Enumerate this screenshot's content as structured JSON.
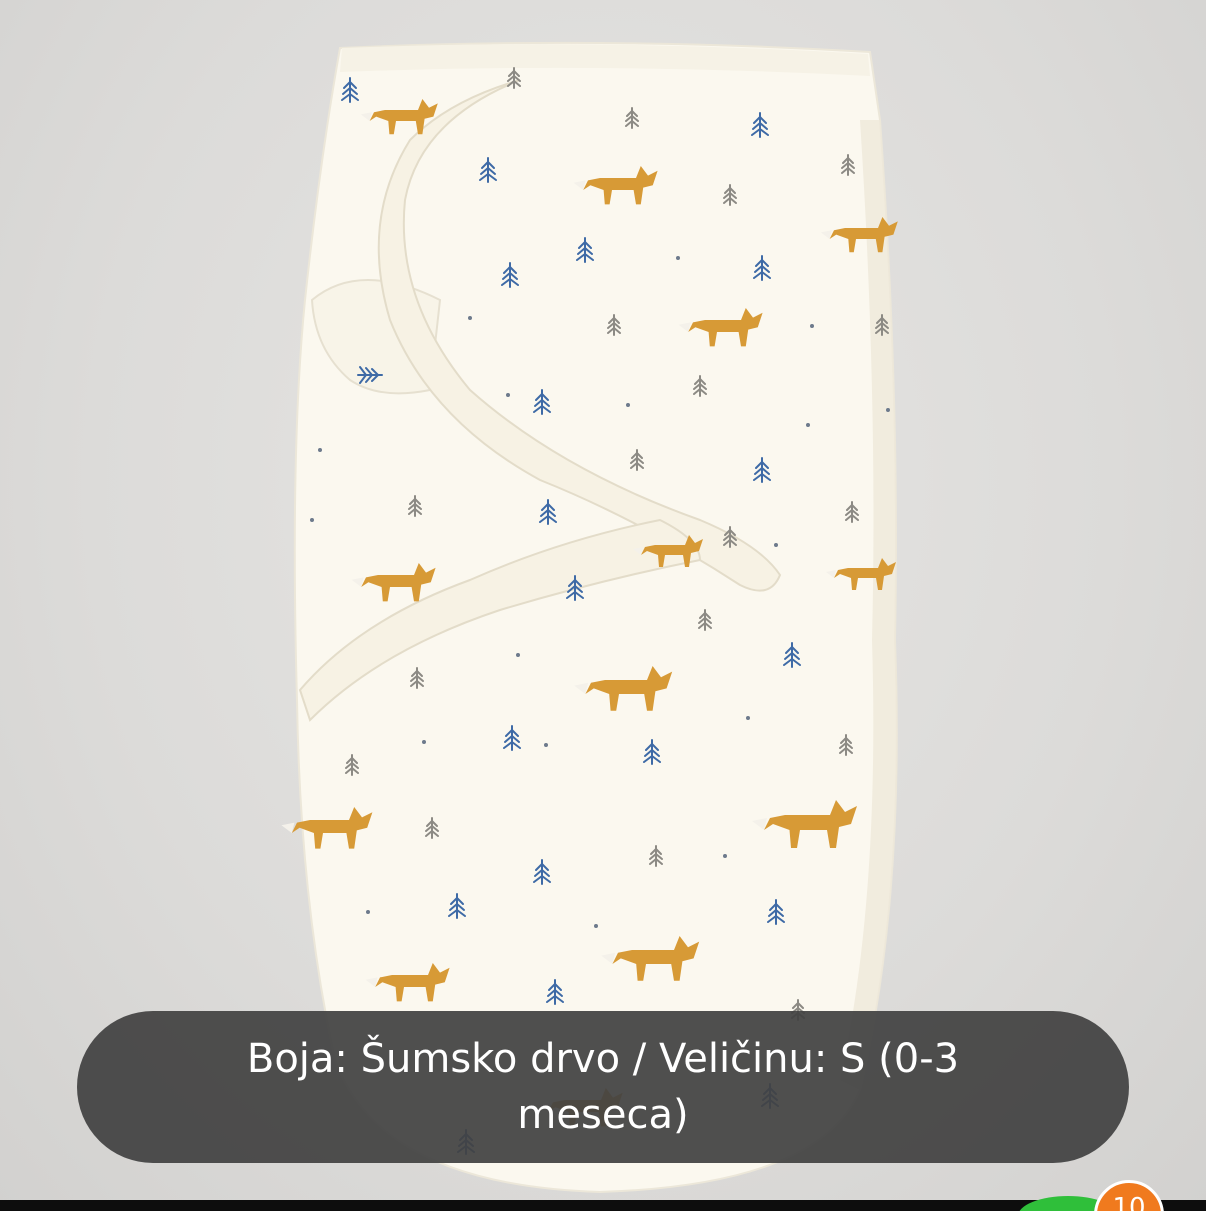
{
  "caption": {
    "text": "Boja: Šumsko drvo / Veličinu: S (0-3 meseca)"
  },
  "badge": {
    "count": "10"
  },
  "colors": {
    "caption_bg": "#424242",
    "fabric": "#fbf8ef",
    "fox": "#d79a36",
    "tree_blue": "#3e6aa6",
    "tree_gray": "#8c8a84",
    "badge": "#f07a1e",
    "badge_green": "#2fbf3a"
  },
  "icons": {
    "photo": "swaddle-product-photo",
    "badge": "notification-count-badge"
  }
}
